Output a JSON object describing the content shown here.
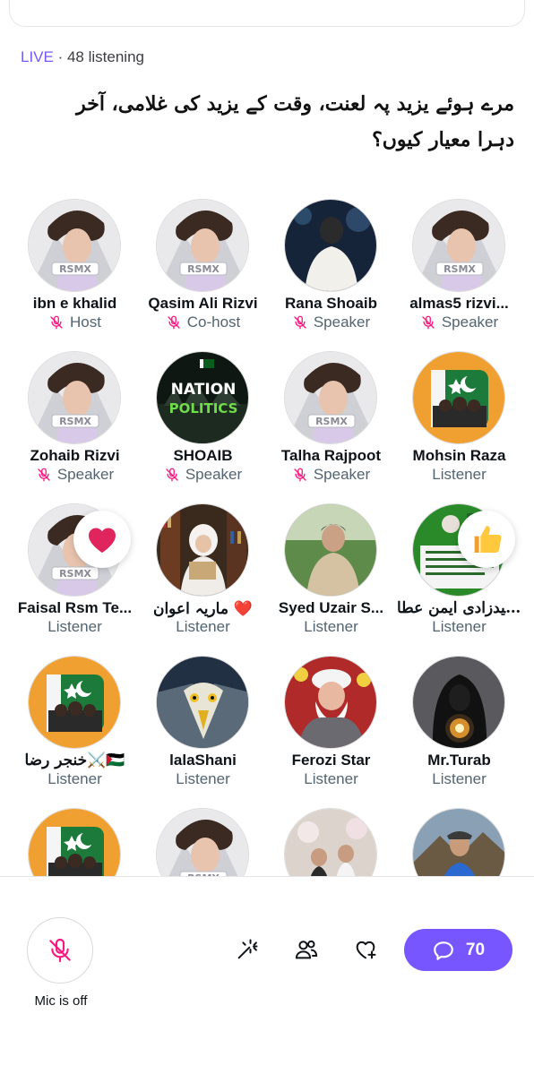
{
  "status": {
    "live": "LIVE",
    "separator": " · ",
    "listening": "48 listening"
  },
  "space_title": "مرے ہوئے یزید پہ لعنت، وقت کے یزید کی غلامی، آخر دہرا معیار کیوں؟",
  "participants": [
    {
      "name": "ibn e khalid",
      "role": "Host",
      "muted": true,
      "avatar": "rsmx-cleric"
    },
    {
      "name": "Qasim Ali Rizvi",
      "role": "Co-host",
      "muted": true,
      "avatar": "rsmx-cleric"
    },
    {
      "name": "Rana Shoaib",
      "role": "Speaker",
      "muted": true,
      "avatar": "man-back-blue"
    },
    {
      "name": "almas5 rizvi...",
      "role": "Speaker",
      "muted": true,
      "avatar": "rsmx-cleric"
    },
    {
      "name": "Zohaib Rizvi",
      "role": "Speaker",
      "muted": true,
      "avatar": "rsmx-cleric"
    },
    {
      "name": "SHOAIB",
      "role": "Speaker",
      "muted": true,
      "avatar": "nation-politics",
      "logo_text_1": "NATION",
      "logo_text_2": "POLITICS"
    },
    {
      "name": "Talha Rajpoot",
      "role": "Speaker",
      "muted": true,
      "avatar": "rsmx-cleric"
    },
    {
      "name": "Mohsin Raza",
      "role": "Listener",
      "muted": false,
      "avatar": "flag-orange"
    },
    {
      "name": "Faisal Rsm Te...",
      "role": "Listener",
      "muted": false,
      "avatar": "rsmx-cleric",
      "reaction": "heart"
    },
    {
      "name": "ماریہ اعوان ❤️",
      "role": "Listener",
      "muted": false,
      "avatar": "woman-library",
      "urdu": true
    },
    {
      "name": "Syed Uzair S...",
      "role": "Listener",
      "muted": false,
      "avatar": "man-outdoor"
    },
    {
      "name": "سیدزادی ایمن عطا...",
      "role": "Listener",
      "muted": false,
      "avatar": "green-banner",
      "reaction": "thumbs-up",
      "urdu": true
    },
    {
      "name": "خنجر رضا⚔️🇵🇸",
      "role": "Listener",
      "muted": false,
      "avatar": "flag-orange",
      "urdu": true
    },
    {
      "name": "lalaShani",
      "role": "Listener",
      "muted": false,
      "avatar": "eagle"
    },
    {
      "name": "Ferozi Star",
      "role": "Listener",
      "muted": false,
      "avatar": "elder-red"
    },
    {
      "name": "Mr.Turab",
      "role": "Listener",
      "muted": false,
      "avatar": "hooded-orb"
    },
    {
      "name": "",
      "role": "",
      "muted": false,
      "avatar": "flag-orange"
    },
    {
      "name": "",
      "role": "",
      "muted": false,
      "avatar": "rsmx-cleric"
    },
    {
      "name": "",
      "role": "",
      "muted": false,
      "avatar": "group-photo"
    },
    {
      "name": "",
      "role": "",
      "muted": false,
      "avatar": "man-mountain"
    }
  ],
  "footer": {
    "mic_label": "Mic is off",
    "comment_count": "70",
    "tools": [
      "effects-wand-icon",
      "people-icon",
      "heart-plus-icon"
    ]
  },
  "colors": {
    "accent": "#7856ff",
    "muted_pink": "#f91880",
    "role_gray": "#536471",
    "flag_orange": "#f0a030",
    "heart_red": "#e0245e"
  }
}
